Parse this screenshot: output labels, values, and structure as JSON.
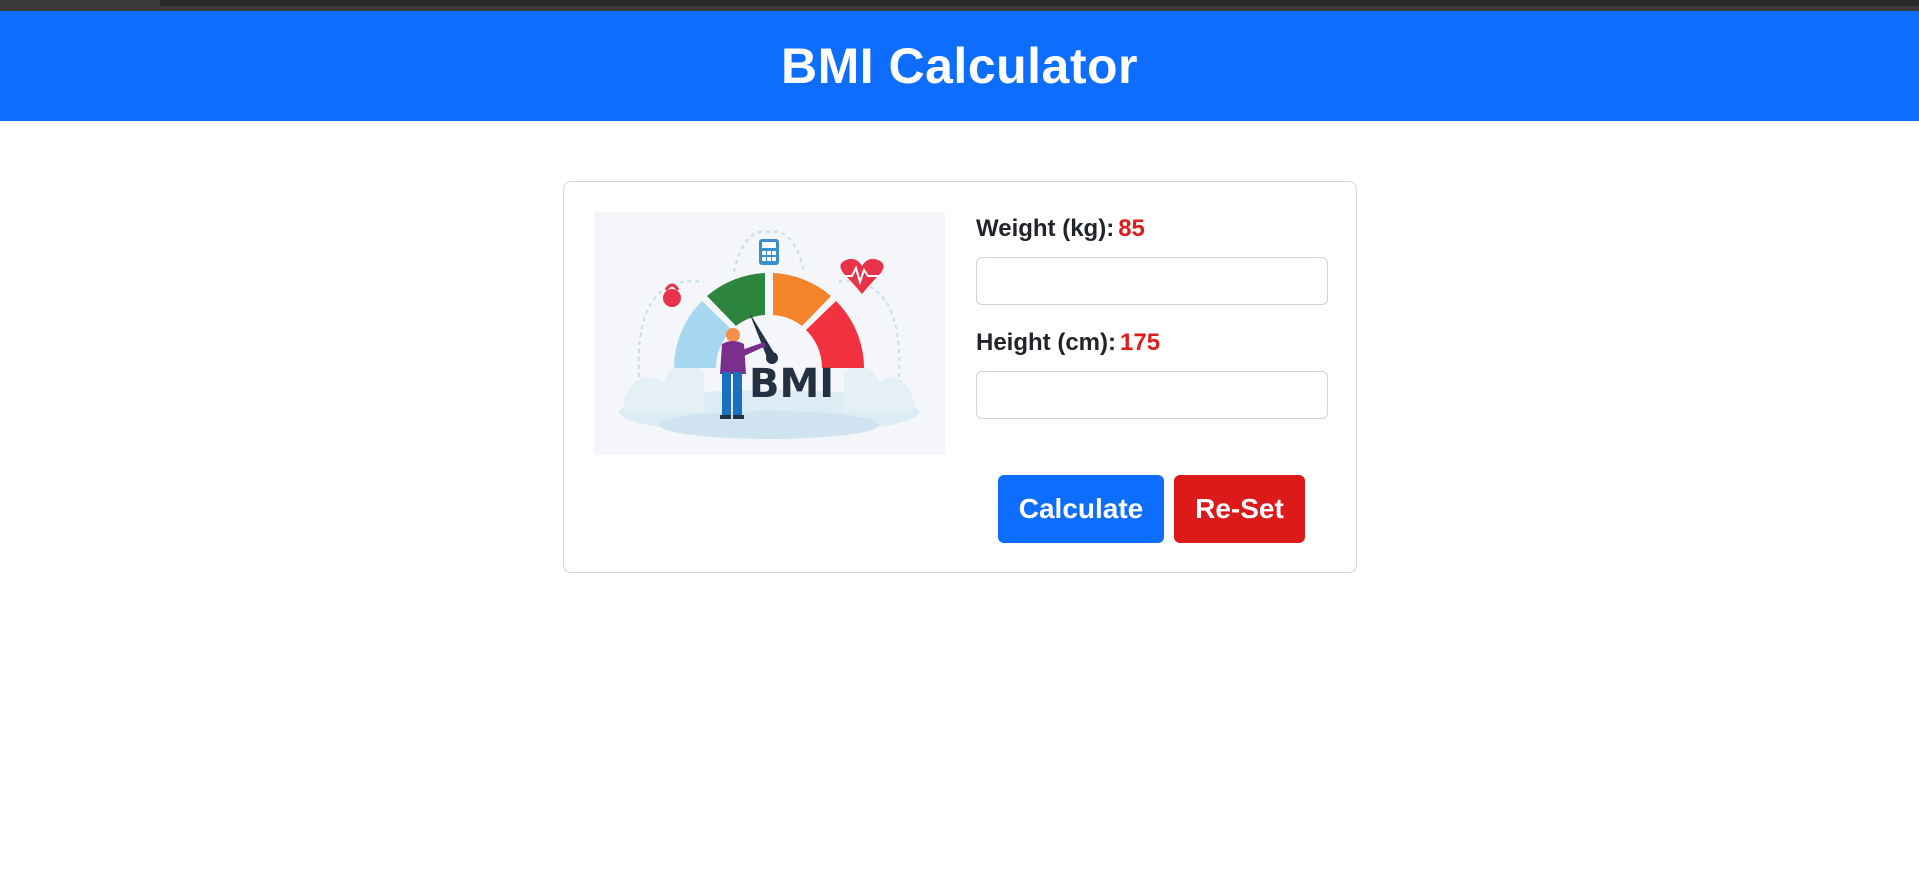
{
  "header": {
    "title": "BMI Calculator"
  },
  "illustration": {
    "text": "BMI",
    "icons": [
      "kettlebell-icon",
      "calculator-icon",
      "heart-rate-icon"
    ]
  },
  "form": {
    "weight": {
      "label": "Weight (kg):",
      "value": "85",
      "input_value": ""
    },
    "height": {
      "label": "Height (cm):",
      "value": "175",
      "input_value": ""
    }
  },
  "buttons": {
    "calculate": "Calculate",
    "reset": "Re-Set"
  },
  "colors": {
    "primary": "#0d6efd",
    "danger": "#dc1a1a",
    "value_red": "#dc1e1e"
  }
}
